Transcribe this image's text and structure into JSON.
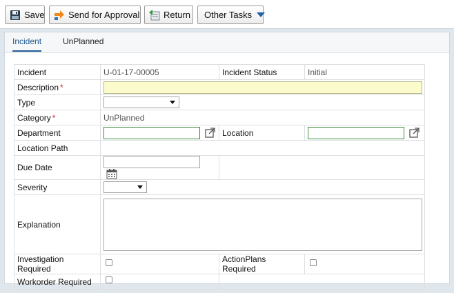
{
  "toolbar": {
    "save_label": "Save",
    "send_label": "Send for Approval",
    "return_label": "Return",
    "other_label": "Other Tasks"
  },
  "tabs": [
    {
      "label": "Incident",
      "active": true
    },
    {
      "label": "UnPlanned",
      "active": false
    }
  ],
  "form": {
    "incident_label": "Incident",
    "incident_value": "U-01-17-00005",
    "status_label": "Incident Status",
    "status_value": "Initial",
    "description_label": "Description",
    "description_value": "",
    "type_label": "Type",
    "type_value": "",
    "category_label": "Category",
    "category_value": "UnPlanned",
    "department_label": "Department",
    "department_value": "",
    "location_label": "Location",
    "location_value": "",
    "location_path_label": "Location Path",
    "due_date_label": "Due Date",
    "due_date_value": "",
    "severity_label": "Severity",
    "severity_value": "",
    "explanation_label": "Explanation",
    "explanation_value": "",
    "investigation_label": "Investigation Required",
    "actionplans_label": "ActionPlans Required",
    "workorder_label": "Workorder Required",
    "required_marker": "*"
  },
  "icons": {
    "save": "floppy-disk-icon",
    "send": "send-arrow-icon",
    "return": "return-document-icon",
    "open": "external-link-icon",
    "calendar": "calendar-icon"
  },
  "colors": {
    "tab_active": "#1e5b93",
    "required": "#d0202a",
    "highlight_input": "#fbfbcc",
    "lookup_border": "#3d8a3d"
  }
}
